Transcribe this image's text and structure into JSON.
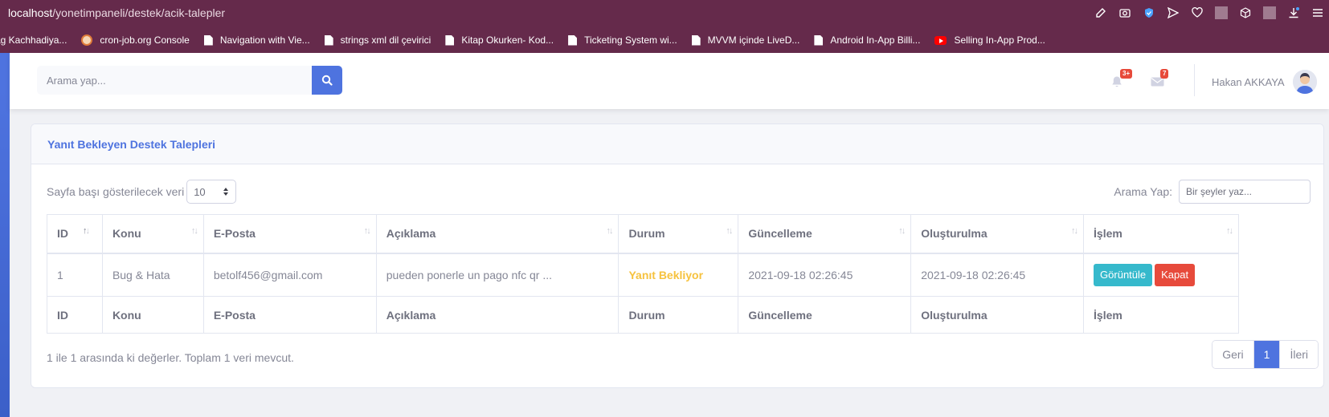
{
  "browser": {
    "url_host": "localhost",
    "url_path": "/yonetimpaneli/destek/acik-talepler",
    "bookmarks": [
      {
        "label": "ag Kachhadiya...",
        "icon": "none"
      },
      {
        "label": "cron-job.org Console",
        "icon": "cron-icon"
      },
      {
        "label": "Navigation with Vie...",
        "icon": "page-icon"
      },
      {
        "label": "strings xml dil çevirici",
        "icon": "page-icon"
      },
      {
        "label": "Kitap Okurken- Kod...",
        "icon": "page-icon"
      },
      {
        "label": "Ticketing System wi...",
        "icon": "page-icon"
      },
      {
        "label": "MVVM içinde LiveD...",
        "icon": "page-icon"
      },
      {
        "label": "Android In-App Billi...",
        "icon": "page-icon"
      },
      {
        "label": "Selling In-App Prod...",
        "icon": "youtube-icon"
      }
    ]
  },
  "topbar": {
    "search_placeholder": "Arama yap...",
    "alerts_badge": "3+",
    "messages_badge": "7",
    "user_name": "Hakan AKKAYA"
  },
  "card": {
    "title": "Yanıt Bekleyen Destek Talepleri",
    "length_label": "Sayfa başı gösterilecek veri",
    "length_value": "10",
    "filter_label": "Arama Yap:",
    "filter_placeholder": "Bir şeyler yaz...",
    "columns": [
      "ID",
      "Konu",
      "E-Posta",
      "Açıklama",
      "Durum",
      "Güncelleme",
      "Oluşturulma",
      "İşlem"
    ],
    "rows": [
      {
        "id": "1",
        "konu": "Bug & Hata",
        "eposta": "betolf456@gmail.com",
        "aciklama": "pueden ponerle un pago nfc qr ...",
        "durum": "Yanıt Bekliyor",
        "guncelleme": "2021-09-18 02:26:45",
        "olusturulma": "2021-09-18 02:26:45",
        "view_label": "Görüntüle",
        "close_label": "Kapat"
      }
    ],
    "info": "1 ile 1 arasında ki değerler. Toplam 1 veri mevcut.",
    "pagination": {
      "prev": "Geri",
      "current": "1",
      "next": "İleri"
    }
  },
  "colors": {
    "primary": "#4e73df",
    "warning": "#f6c23e",
    "info": "#36b9cc",
    "danger": "#e74a3b",
    "browser": "#652a4b"
  }
}
